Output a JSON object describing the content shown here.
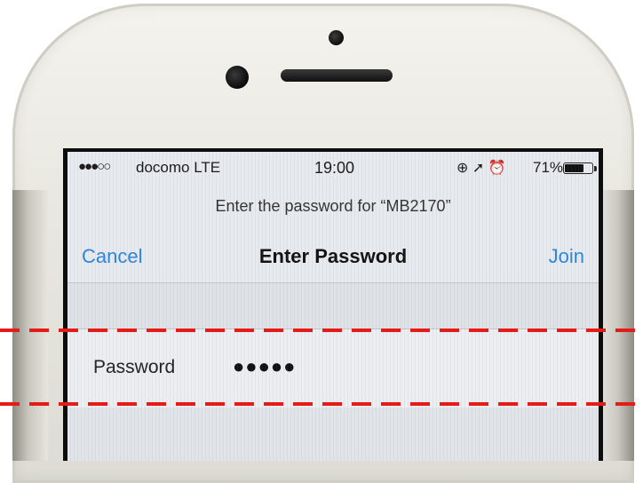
{
  "status_bar": {
    "signal": "●●●○○",
    "carrier": "docomo LTE",
    "time": "19:00",
    "icons": "⊕ ➚ ⏰",
    "battery_percent": "71%",
    "battery_level": 0.71
  },
  "prompt": "Enter the password for “MB2170”",
  "nav": {
    "cancel_label": "Cancel",
    "title": "Enter Password",
    "join_label": "Join"
  },
  "password_field": {
    "label": "Password",
    "value": "●●●●●"
  },
  "colors": {
    "accent": "#2f86d8",
    "annotation": "#e41b17"
  }
}
